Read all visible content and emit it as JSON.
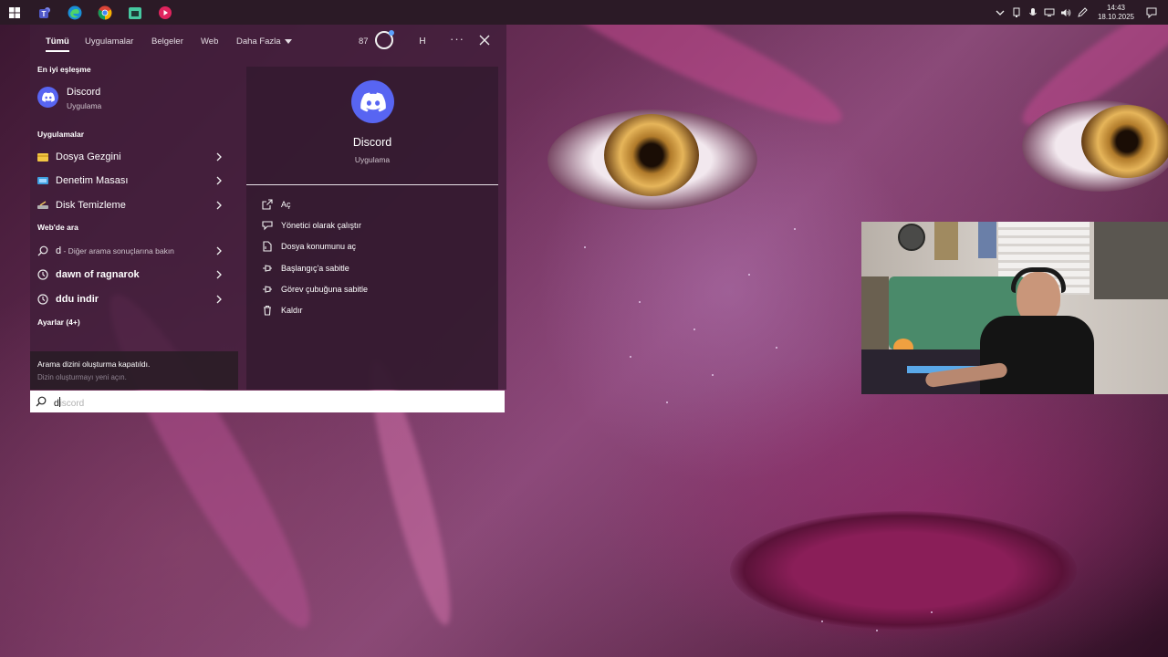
{
  "taskbar": {
    "apps": [
      {
        "name": "windows-start"
      },
      {
        "name": "teams"
      },
      {
        "name": "edge"
      },
      {
        "name": "chrome"
      },
      {
        "name": "store"
      },
      {
        "name": "media-player"
      }
    ],
    "clock": {
      "time": "14:43",
      "date": "18.10.2025"
    }
  },
  "search": {
    "tabs": [
      "Tümü",
      "Uygulamalar",
      "Belgeler",
      "Web",
      "Daha Fazla"
    ],
    "points": "87",
    "avatar_initial": "H",
    "more": "···",
    "best_match_heading": "En iyi eşleşme",
    "best_match": {
      "title": "Discord",
      "subtitle": "Uygulama"
    },
    "apps_heading": "Uygulamalar",
    "apps": [
      {
        "label": "Dosya Gezgini",
        "icon": "folder-icon"
      },
      {
        "label": "Denetim Masası",
        "icon": "control-panel-icon"
      },
      {
        "label": "Disk Temizleme",
        "icon": "disk-cleanup-icon"
      }
    ],
    "web_heading": "Web'de ara",
    "web_first": {
      "query": "d",
      "suffix": " - Diğer arama sonuçlarına bakın"
    },
    "web_history": [
      "dawn of ragnarok",
      "ddu indir"
    ],
    "settings_heading": "Ayarlar (4+)",
    "notice": {
      "title": "Arama dizini oluşturma kapatıldı.",
      "subtitle": "Dizin oluşturmayı yeni açın."
    },
    "detail": {
      "title": "Discord",
      "subtitle": "Uygulama",
      "actions": [
        "Aç",
        "Yönetici olarak çalıştır",
        "Dosya konumunu aç",
        "Başlangıç'a sabitle",
        "Görev çubuğuna sabitle",
        "Kaldır"
      ]
    },
    "input": {
      "value": "d",
      "suggestion_rest": "iscord"
    }
  },
  "colors": {
    "discord": "#5865f2",
    "panel": "#401e3a",
    "taskbar": "#2b1a26"
  }
}
